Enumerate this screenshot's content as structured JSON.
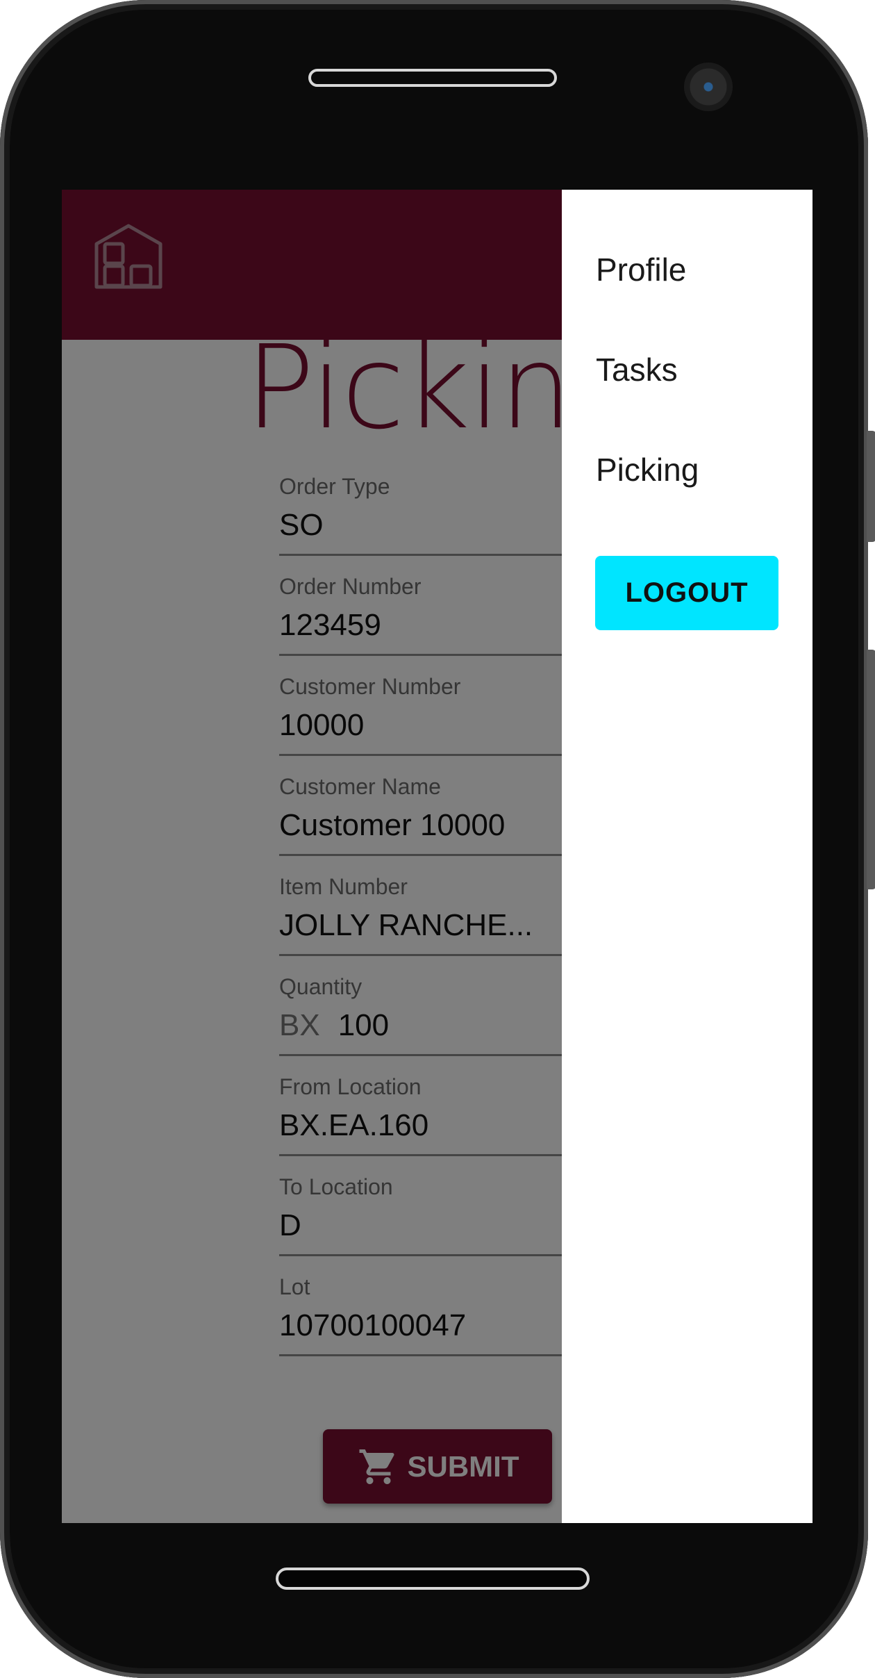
{
  "page": {
    "title": "Picking"
  },
  "form": {
    "fields": [
      {
        "label": "Order Type",
        "value": "SO"
      },
      {
        "label": "Order Number",
        "value": "123459"
      },
      {
        "label": "Customer Number",
        "value": "10000"
      },
      {
        "label": "Customer Name",
        "value": "Customer 10000"
      },
      {
        "label": "Item Number",
        "value": "JOLLY RANCHE..."
      },
      {
        "label": "Quantity",
        "prefix": "BX",
        "value": "100"
      },
      {
        "label": "From Location",
        "value": "BX.EA.160"
      },
      {
        "label": "To Location",
        "value": "D"
      },
      {
        "label": "Lot",
        "value": "10700100047"
      }
    ],
    "submit_label": "SUBMIT"
  },
  "drawer": {
    "items": [
      "Profile",
      "Tasks",
      "Picking"
    ],
    "logout_label": "LOGOUT"
  },
  "icons": {
    "logo": "warehouse-icon",
    "submit": "cart-icon"
  },
  "colors": {
    "brand": "#780f30",
    "accent": "#00e5ff",
    "scrim": "rgba(0,0,0,0.5)"
  }
}
